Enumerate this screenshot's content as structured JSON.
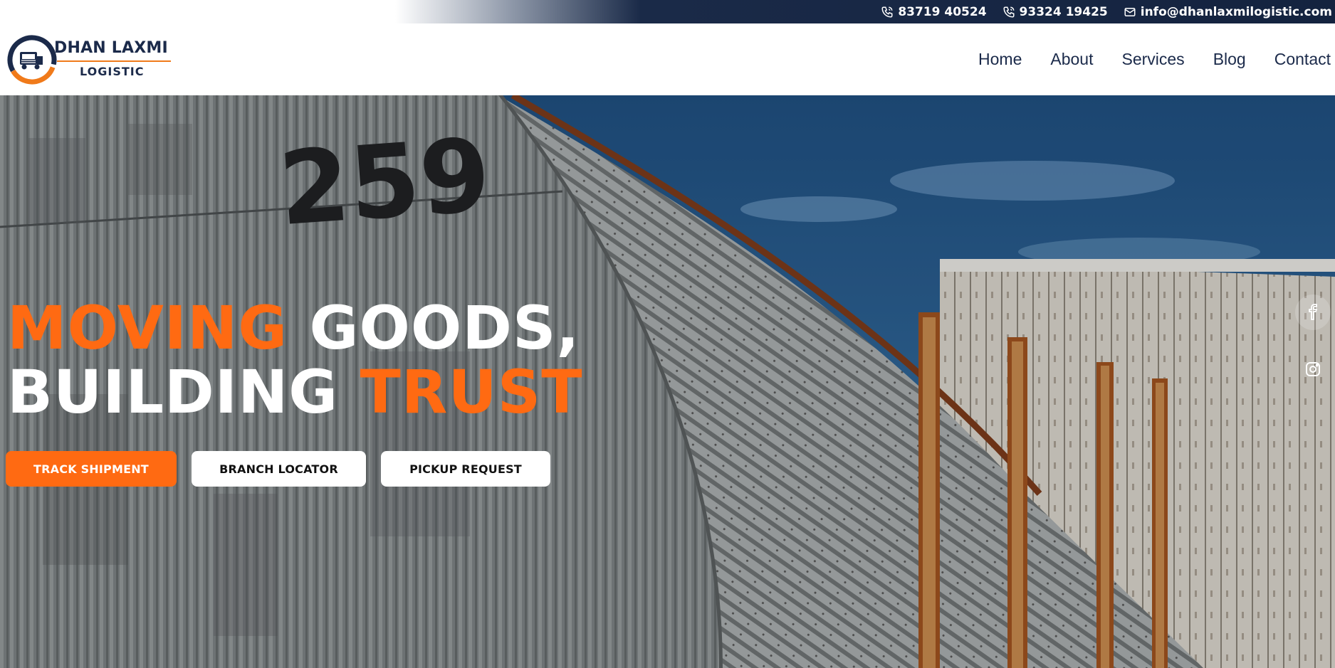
{
  "topbar": {
    "phone_1": "83719 40524",
    "phone_2": "93324 19425",
    "email": "info@dhanlaxmilogistic.com",
    "icons": [
      "phone-icon",
      "phone-icon",
      "mail-icon"
    ]
  },
  "brand": {
    "name_line1": "DHAN LAXMI",
    "name_line2": "LOGISTIC",
    "colors": {
      "navy": "#1b2a4a",
      "orange": "#f07a1a"
    }
  },
  "nav": {
    "items": [
      "Home",
      "About",
      "Services",
      "Blog",
      "Contact"
    ]
  },
  "hero": {
    "headline": {
      "w1": "MOVING",
      "w2": "GOODS,",
      "w3": "BUILDING",
      "w4": "TRUST"
    },
    "building_number": "259",
    "buttons": {
      "track": "TRACK SHIPMENT",
      "branch": "BRANCH LOCATOR",
      "pickup": "PICKUP REQUEST"
    },
    "social": [
      "facebook-icon",
      "instagram-icon"
    ],
    "colors": {
      "accent": "#ff6a12",
      "sky": "#2a5e8f",
      "metal": "#8e9394"
    }
  }
}
